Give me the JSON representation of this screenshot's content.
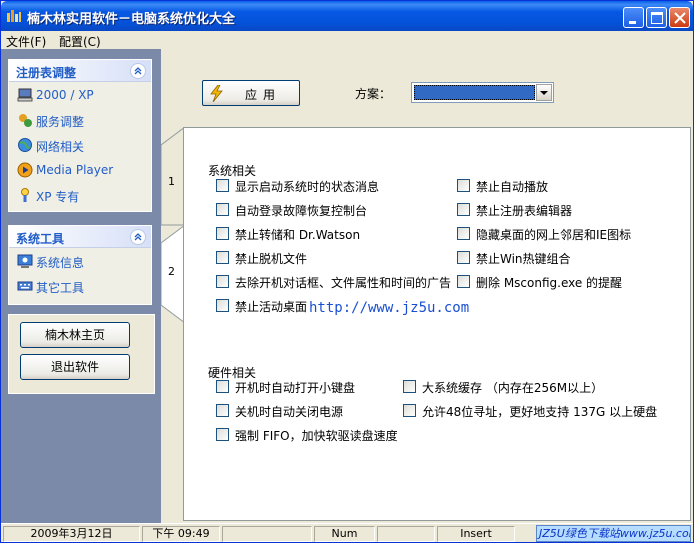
{
  "window": {
    "title": "楠木林实用软件－电脑系统优化大全"
  },
  "menu": [
    {
      "label": "文件(F)"
    },
    {
      "label": "配置(C)"
    }
  ],
  "sidebar": {
    "registry_group": {
      "title": "注册表调整",
      "items": [
        {
          "label": "2000 / XP",
          "icon": "computer-icon"
        },
        {
          "label": "服务调整",
          "icon": "services-icon"
        },
        {
          "label": "网络相关",
          "icon": "network-globe-icon"
        },
        {
          "label": "Media Player",
          "icon": "media-player-icon"
        },
        {
          "label": "XP 专有",
          "icon": "xp-tool-icon"
        }
      ]
    },
    "tools_group": {
      "title": "系统工具",
      "items": [
        {
          "label": "系统信息",
          "icon": "system-info-icon"
        },
        {
          "label": "其它工具",
          "icon": "keyboard-icon"
        }
      ]
    },
    "home_button": "楠木林主页",
    "exit_button": "退出软件"
  },
  "toolbar": {
    "apply_label": "应用",
    "scheme_label": "方案：",
    "scheme_value": ""
  },
  "tabs": [
    {
      "label": "1"
    },
    {
      "label": "2"
    }
  ],
  "system_section": {
    "title": "系统相关",
    "left_options": [
      "显示启动系统时的状态消息",
      "自动登录故障恢复控制台",
      "禁止转储和 Dr.Watson",
      "禁止脱机文件",
      "去除开机对话框、文件属性和时间的广告",
      "禁止活动桌面"
    ],
    "right_options": [
      "禁止自动播放",
      "禁止注册表编辑器",
      "隐藏桌面的网上邻居和IE图标",
      "禁止Win热键组合",
      "删除 Msconfig.exe 的提醒"
    ]
  },
  "watermark_url": "http://www.jz5u.com",
  "hardware_section": {
    "title": "硬件相关",
    "left_options": [
      "开机时自动打开小键盘",
      "关机时自动关闭电源",
      "强制 FIFO，加快软驱读盘速度"
    ],
    "right_options": [
      "大系统缓存 （内存在256M以上）",
      "允许48位寻址，更好地支持 137G 以上硬盘"
    ]
  },
  "statusbar": {
    "date": "2009年3月12日",
    "time": "下午 09:49",
    "num": "Num",
    "insert": "Insert",
    "banner": "JZ5U绿色下载站www.jz5u.com"
  },
  "colors": {
    "titlebar": "#0758e3",
    "sidebar_bg": "#7b8aa9",
    "link_blue": "#215dc6",
    "combo_selection": "#316ac5"
  }
}
